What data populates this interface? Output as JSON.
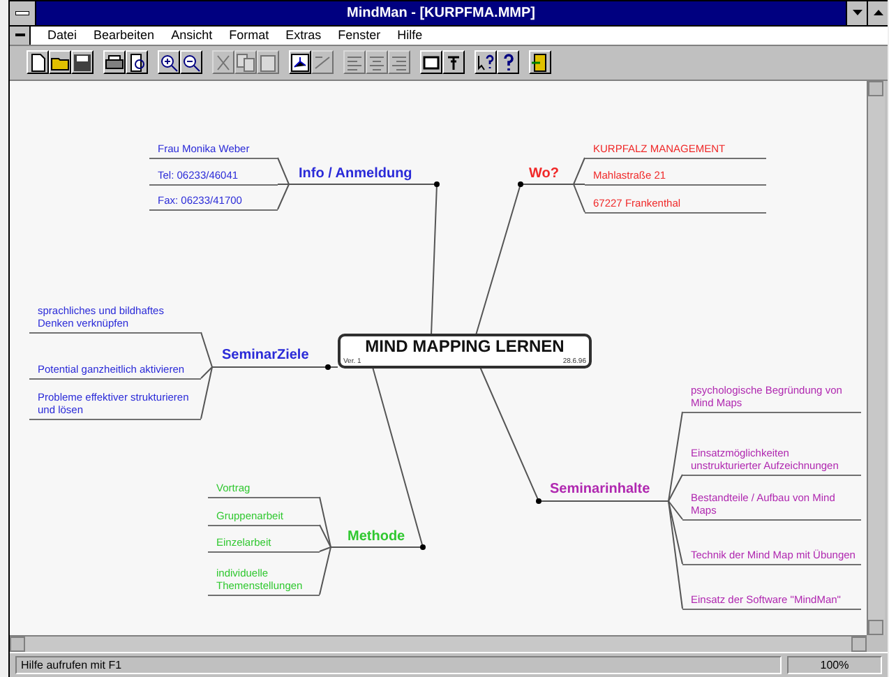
{
  "window": {
    "title": "MindMan - [KURPFMA.MMP]"
  },
  "menu": [
    "Datei",
    "Bearbeiten",
    "Ansicht",
    "Format",
    "Extras",
    "Fenster",
    "Hilfe"
  ],
  "toolbar": [
    [
      {
        "kind": "new",
        "disabled": false
      },
      {
        "kind": "open",
        "disabled": false
      },
      {
        "kind": "save",
        "disabled": false
      }
    ],
    [
      {
        "kind": "print",
        "disabled": false
      },
      {
        "kind": "preview",
        "disabled": false
      }
    ],
    [
      {
        "kind": "zoom-in",
        "disabled": false
      },
      {
        "kind": "zoom-out",
        "disabled": false
      }
    ],
    [
      {
        "kind": "cut",
        "disabled": true
      },
      {
        "kind": "copy",
        "disabled": true
      },
      {
        "kind": "paste",
        "disabled": true
      }
    ],
    [
      {
        "kind": "branch",
        "disabled": false
      },
      {
        "kind": "link",
        "disabled": true
      }
    ],
    [
      {
        "kind": "align-left",
        "disabled": true
      },
      {
        "kind": "align-center",
        "disabled": true
      },
      {
        "kind": "align-right",
        "disabled": true
      }
    ],
    [
      {
        "kind": "frame",
        "disabled": false
      },
      {
        "kind": "pin",
        "disabled": false
      }
    ],
    [
      {
        "kind": "context-help",
        "disabled": false
      },
      {
        "kind": "help",
        "disabled": false
      }
    ],
    [
      {
        "kind": "exit",
        "disabled": false
      }
    ]
  ],
  "map": {
    "center": {
      "title": "MIND MAPPING LERNEN",
      "version": "Ver. 1",
      "date": "28.6.96"
    },
    "branches": [
      {
        "label": "Info / Anmeldung",
        "color": "#2a2ad8",
        "items": [
          "Frau Monika Weber",
          "Tel: 06233/46041",
          "Fax: 06233/41700"
        ]
      },
      {
        "label": "Wo?",
        "color": "#f02828",
        "items": [
          "KURPFALZ MANAGEMENT",
          "Mahlastraße 21",
          "67227 Frankenthal"
        ]
      },
      {
        "label": "SeminarZiele",
        "color": "#2a2ad8",
        "items": [
          "sprachliches und bildhaftes Denken verknüpfen",
          "Potential ganzheitlich aktivieren",
          "Probleme effektiver strukturieren und lösen"
        ]
      },
      {
        "label": "Methode",
        "color": "#30c830",
        "items": [
          "Vortrag",
          "Gruppenarbeit",
          "Einzelarbeit",
          "individuelle Themenstellungen"
        ]
      },
      {
        "label": "Seminarinhalte",
        "color": "#b028b0",
        "items": [
          "psychologische Begründung von Mind Maps",
          "Einsatzmöglichkeiten unstrukturierter Aufzeichnungen",
          "Bestandteile / Aufbau von Mind Maps",
          "Technik der Mind Map mit Übungen",
          "Einsatz der Software \"MindMan\""
        ]
      }
    ]
  },
  "status_bar": {
    "message": "Hilfe aufrufen mit F1",
    "zoom": "100%"
  }
}
